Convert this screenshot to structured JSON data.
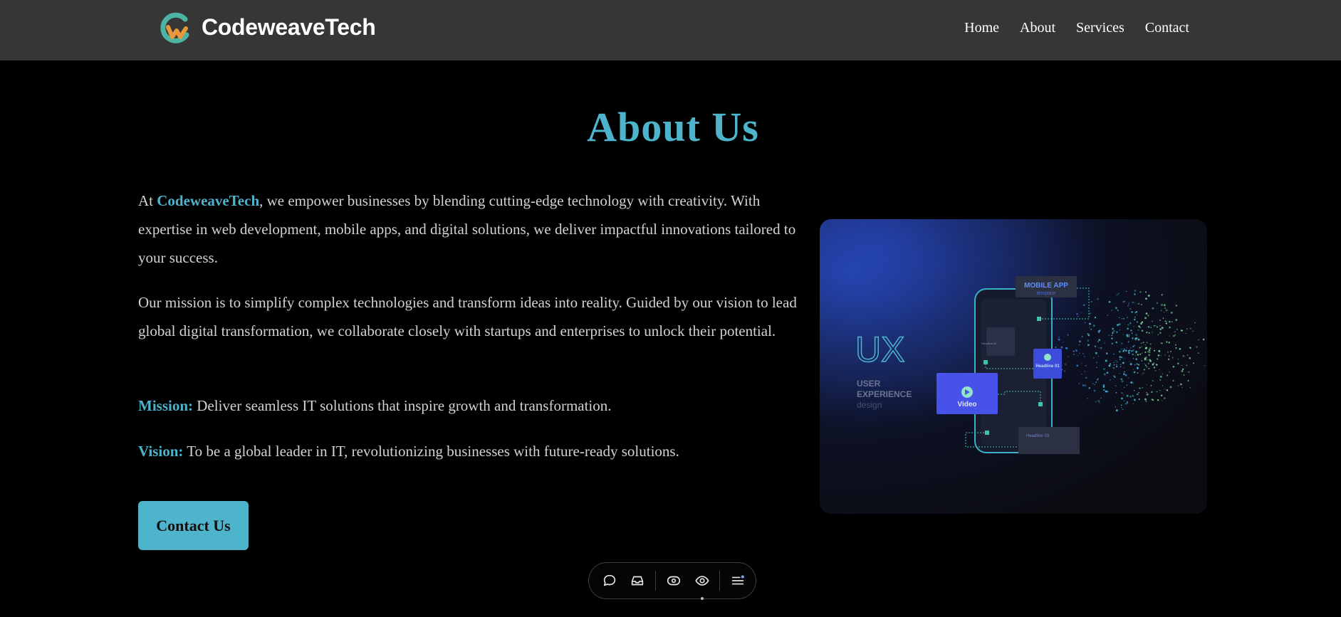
{
  "header": {
    "brand": "CodeweaveTech",
    "nav": [
      "Home",
      "About",
      "Services",
      "Contact"
    ]
  },
  "main": {
    "title": "About Us",
    "intro": {
      "prefix": "At ",
      "brand": "CodeweaveTech",
      "text": ", we empower businesses by blending cutting-edge technology with creativity. With expertise in web development, mobile apps, and digital solutions, we deliver impactful innovations tailored to your success."
    },
    "mission_paragraph": "Our mission is to simplify complex technologies and transform ideas into reality. Guided by our vision to lead global digital transformation, we collaborate closely with startups and enterprises to unlock their potential.",
    "mission": {
      "label": "Mission:",
      "text": " Deliver seamless IT solutions that inspire growth and transformation."
    },
    "vision": {
      "label": "Vision:",
      "text": " To be a global leader in IT, revolutionizing businesses with future-ready solutions."
    },
    "cta": "Contact Us"
  },
  "hero_image": {
    "ux": "UX",
    "caption_line1": "USER",
    "caption_line2": "EXPERIENCE",
    "caption_line3": "design",
    "card_mobile_app": "MOBILE APP",
    "card_mobile_sub": "template",
    "card_video": "Video",
    "card_headline_1": "Headline 01",
    "card_headline_2": "Headline 02",
    "card_headline_3": "Headline 03"
  },
  "toolbar": {
    "icons": [
      "comment-icon",
      "inbox-icon",
      "eye-outline-icon",
      "eye-icon",
      "menu-icon"
    ]
  },
  "colors": {
    "accent": "#4db4cc",
    "navbar_bg": "#363636",
    "page_bg": "#000000",
    "logo_teal": "#4db4a4",
    "logo_orange": "#e8973a"
  }
}
